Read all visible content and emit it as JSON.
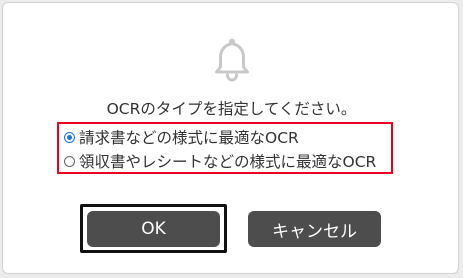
{
  "dialog": {
    "icon": "bell-icon",
    "message": "OCRのタイプを指定してください。",
    "options": [
      {
        "label": "請求書などの様式に最適なOCR",
        "selected": true
      },
      {
        "label": "領収書やレシートなどの様式に最適なOCR",
        "selected": false
      }
    ],
    "buttons": {
      "ok_label": "OK",
      "cancel_label": "キャンセル"
    }
  },
  "colors": {
    "highlight_border": "#e8001c",
    "button_bg": "#4d4d4d",
    "radio_selected": "#1a73e8",
    "icon_color": "#c8c8c8"
  }
}
